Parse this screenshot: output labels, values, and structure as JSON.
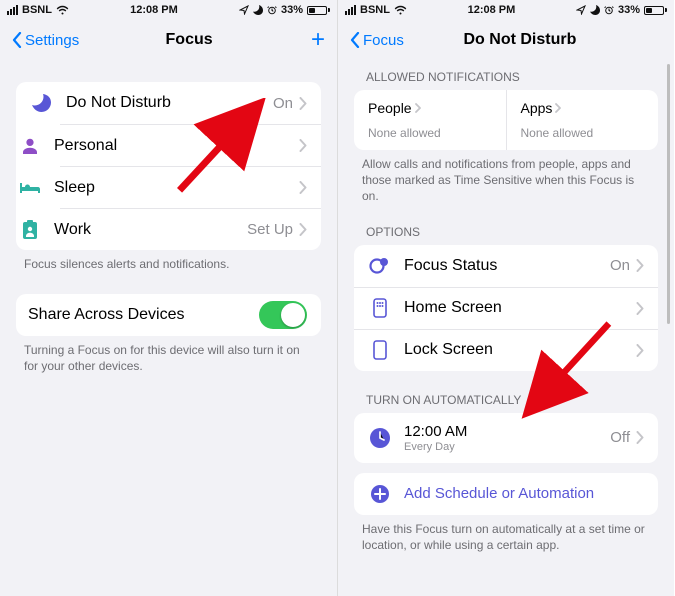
{
  "status": {
    "carrier": "BSNL",
    "time": "12:08 PM",
    "battery_pct": "33%"
  },
  "left": {
    "back": "Settings",
    "title": "Focus",
    "items": [
      {
        "label": "Do Not Disturb",
        "status": "On"
      },
      {
        "label": "Personal",
        "status": ""
      },
      {
        "label": "Sleep",
        "status": ""
      },
      {
        "label": "Work",
        "status": "Set Up"
      }
    ],
    "footer1": "Focus silences alerts and notifications.",
    "share_label": "Share Across Devices",
    "footer2": "Turning a Focus on for this device will also turn it on for your other devices."
  },
  "right": {
    "back": "Focus",
    "title": "Do Not Disturb",
    "allowed_header": "ALLOWED NOTIFICATIONS",
    "people_label": "People",
    "people_value": "None allowed",
    "apps_label": "Apps",
    "apps_value": "None allowed",
    "allowed_footer": "Allow calls and notifications from people, apps and those marked as Time Sensitive when this Focus is on.",
    "options_header": "OPTIONS",
    "options": [
      {
        "label": "Focus Status",
        "status": "On"
      },
      {
        "label": "Home Screen",
        "status": ""
      },
      {
        "label": "Lock Screen",
        "status": ""
      }
    ],
    "auto_header": "TURN ON AUTOMATICALLY",
    "schedule_time": "12:00 AM",
    "schedule_repeat": "Every Day",
    "schedule_status": "Off",
    "add_label": "Add Schedule or Automation",
    "auto_footer": "Have this Focus turn on automatically at a set time or location, or while using a certain app."
  }
}
